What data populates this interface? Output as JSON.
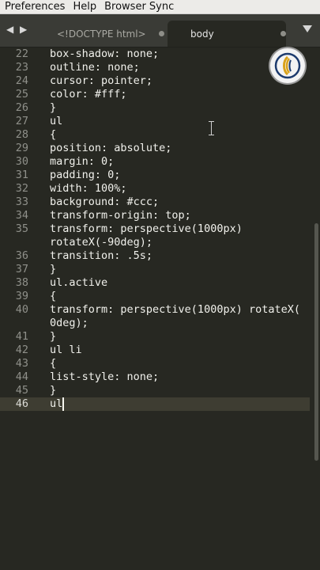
{
  "menu": {
    "items": [
      "Preferences",
      "Help",
      "Browser Sync"
    ]
  },
  "tabs": {
    "nav_icon": "chevron-left-right-icon",
    "inactive_label": "<!DOCTYPE html>",
    "active_label": "body",
    "dropdown_icon": "tab-list-dropdown-icon"
  },
  "editor": {
    "lines": [
      {
        "num": "22",
        "text": "box-shadow: none;"
      },
      {
        "num": "23",
        "text": "outline: none;"
      },
      {
        "num": "24",
        "text": "cursor: pointer;"
      },
      {
        "num": "25",
        "text": "color: #fff;"
      },
      {
        "num": "26",
        "text": "}"
      },
      {
        "num": "27",
        "text": "ul"
      },
      {
        "num": "28",
        "text": "{"
      },
      {
        "num": "29",
        "text": "position: absolute;"
      },
      {
        "num": "30",
        "text": "margin: 0;"
      },
      {
        "num": "31",
        "text": "padding: 0;"
      },
      {
        "num": "32",
        "text": "width: 100%;"
      },
      {
        "num": "33",
        "text": "background: #ccc;"
      },
      {
        "num": "34",
        "text": "transform-origin: top;"
      },
      {
        "num": "35",
        "text": "transform: perspective(1000px)"
      },
      {
        "num": "",
        "text": "rotateX(-90deg);"
      },
      {
        "num": "36",
        "text": "transition: .5s;"
      },
      {
        "num": "37",
        "text": "}"
      },
      {
        "num": "38",
        "text": "ul.active"
      },
      {
        "num": "39",
        "text": "{"
      },
      {
        "num": "40",
        "text": "transform: perspective(1000px) rotateX("
      },
      {
        "num": "",
        "text": "0deg);"
      },
      {
        "num": "41",
        "text": "}"
      },
      {
        "num": "42",
        "text": "ul li"
      },
      {
        "num": "43",
        "text": "{"
      },
      {
        "num": "44",
        "text": "list-style: none;"
      },
      {
        "num": "45",
        "text": "}"
      },
      {
        "num": "46",
        "text": "ul"
      }
    ],
    "current_line": "46",
    "logo_icon": "channel-logo-icon"
  },
  "colors": {
    "editor_bg": "#272822",
    "tab_bar_bg": "#3a3b36",
    "current_line_bg": "#3e3d32",
    "text": "#f1f1ec",
    "line_number": "#8f908a"
  }
}
